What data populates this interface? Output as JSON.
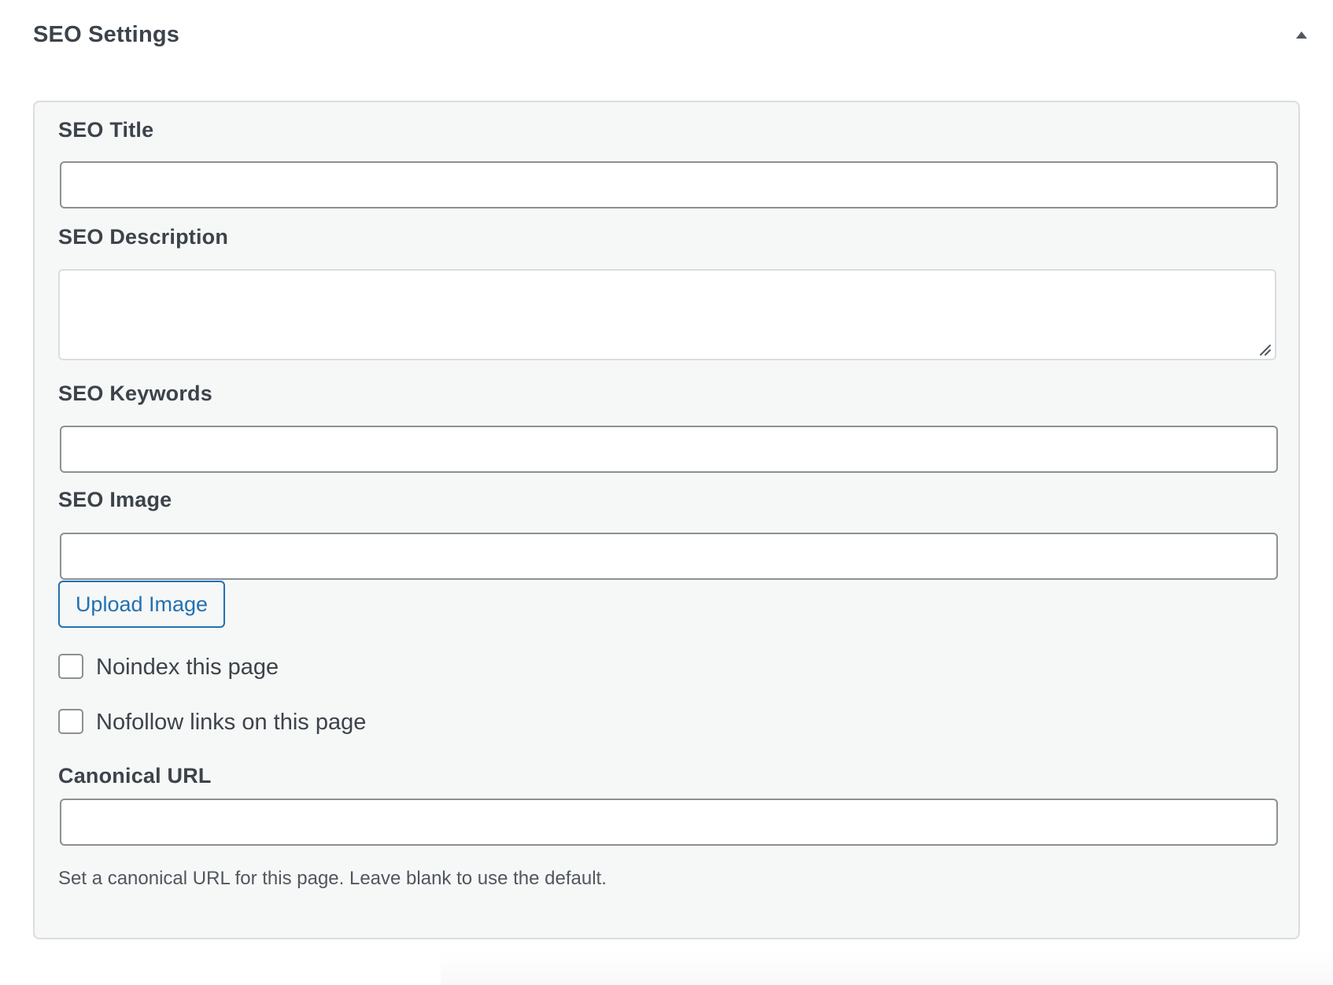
{
  "metabox": {
    "title": "SEO Settings",
    "toggle_icon": "triangle-up-icon"
  },
  "fields": {
    "seo_title": {
      "label": "SEO Title",
      "value": "",
      "placeholder": ""
    },
    "seo_description": {
      "label": "SEO Description",
      "value": "",
      "placeholder": ""
    },
    "seo_keywords": {
      "label": "SEO Keywords",
      "value": "",
      "placeholder": ""
    },
    "seo_image": {
      "label": "SEO Image",
      "value": "",
      "placeholder": "",
      "upload_button_label": "Upload Image"
    },
    "noindex": {
      "label": "Noindex this page",
      "checked": false
    },
    "nofollow": {
      "label": "Nofollow links on this page",
      "checked": false
    },
    "canonical_url": {
      "label": "Canonical URL",
      "value": "",
      "placeholder": "",
      "help": "Set a canonical URL for this page. Leave blank to use the default."
    }
  },
  "colors": {
    "panel_background": "#f6f7f7",
    "panel_border": "#dcdcde",
    "input_border": "#8c8f94",
    "accent": "#2271b1",
    "label_text": "#3c434a",
    "help_text": "#50575e"
  }
}
